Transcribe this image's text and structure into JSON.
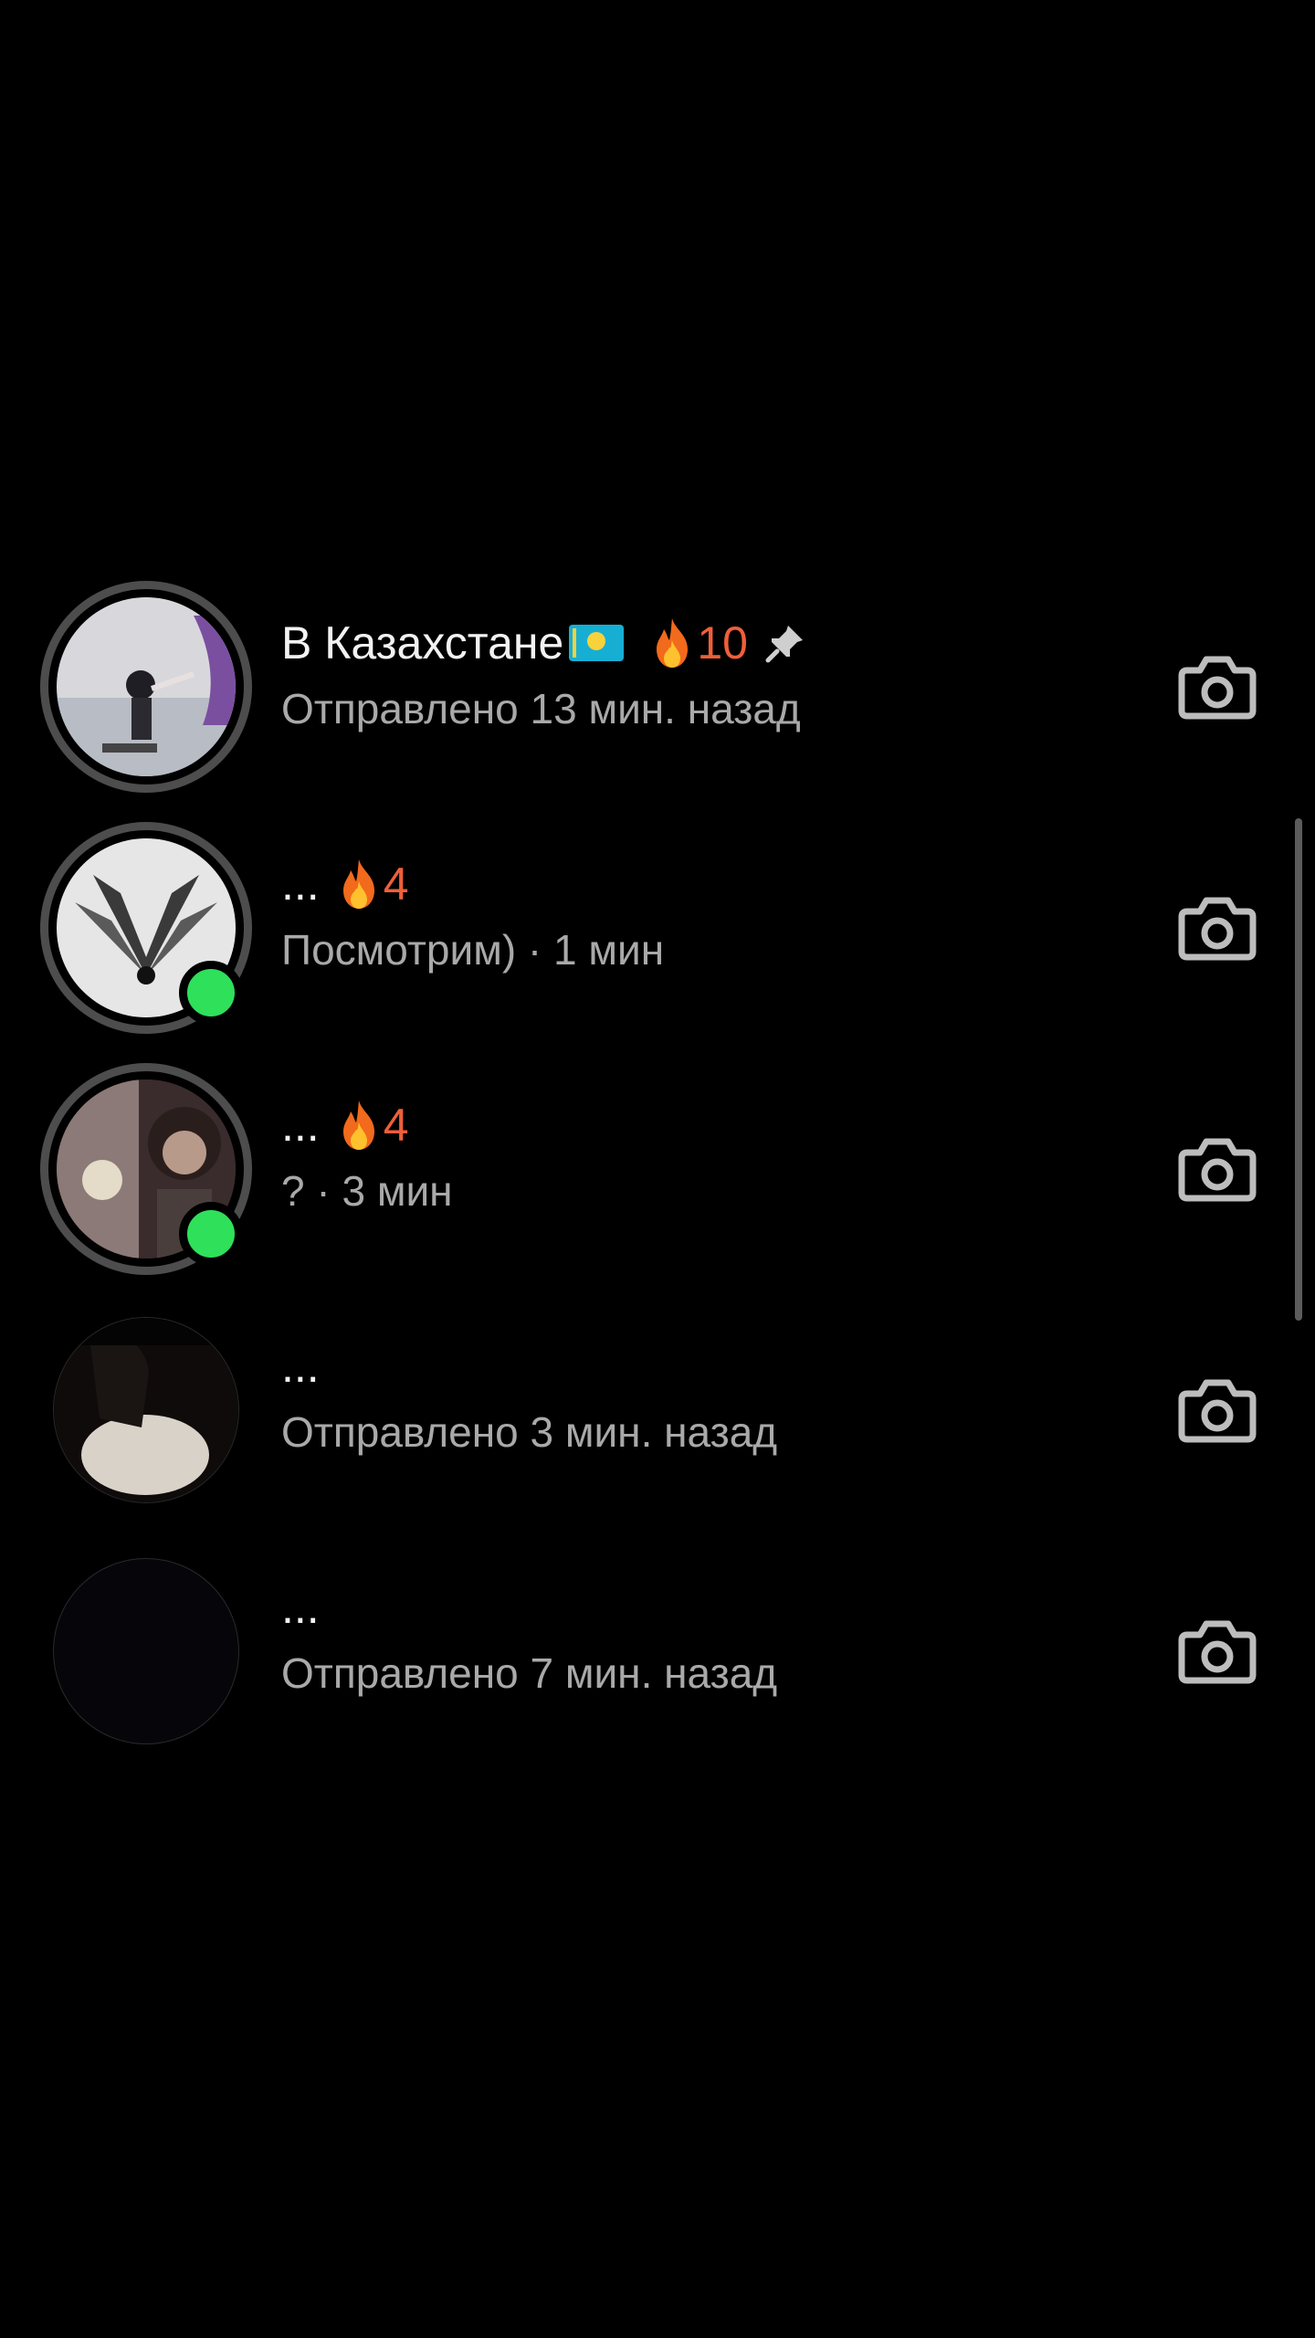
{
  "colors": {
    "background": "#000000",
    "primary_text": "#f2f2f2",
    "secondary_text": "#a9a9a9",
    "streak": "#ef5f3a",
    "online": "#2ee05a",
    "ring": "#4d4d4d"
  },
  "chats": [
    {
      "name": "В Казахстане",
      "flag_icon": "kazakhstan-flag",
      "streak": "10",
      "pinned": true,
      "status": "Отправлено 13 мин. назад",
      "online": false,
      "has_story_ring": true
    },
    {
      "name": "...",
      "streak": "4",
      "pinned": false,
      "status": "Посмотрим) · 1 мин",
      "online": true,
      "has_story_ring": true
    },
    {
      "name": "...",
      "streak": "4",
      "pinned": false,
      "status": "? · 3 мин",
      "online": true,
      "has_story_ring": true
    },
    {
      "name": "...",
      "status": "Отправлено 3 мин. назад",
      "online": false,
      "has_story_ring": false
    },
    {
      "name": "...",
      "status": "Отправлено 7 мин. назад",
      "online": false,
      "has_story_ring": false
    }
  ]
}
